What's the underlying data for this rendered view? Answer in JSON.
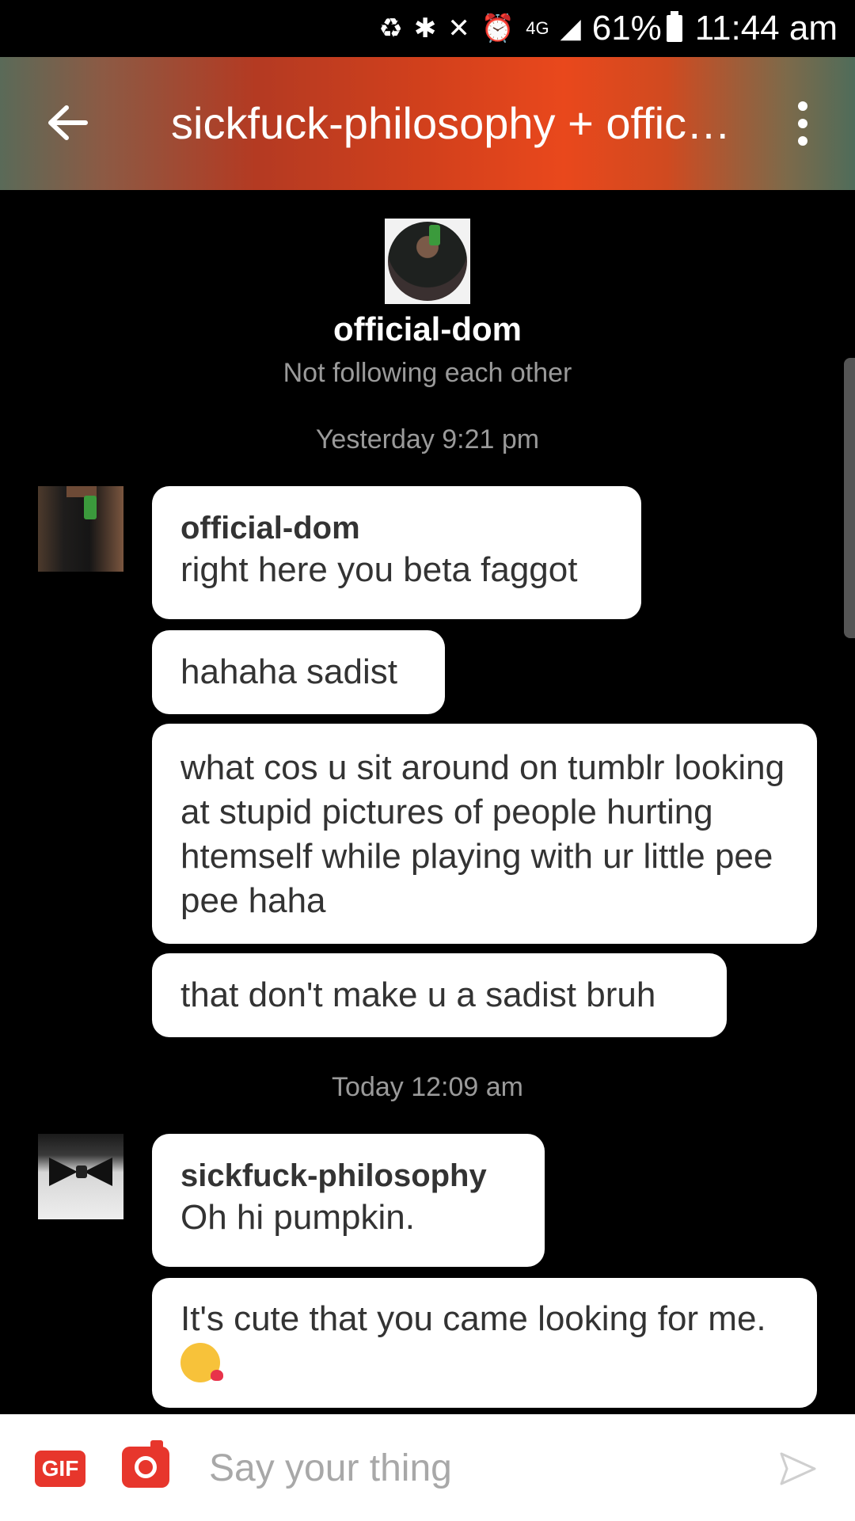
{
  "status_bar": {
    "battery_percent": "61%",
    "time": "11:44 am",
    "network": "4G",
    "icons": [
      "recycle-icon",
      "bluetooth-icon",
      "mute-icon",
      "alarm-icon",
      "network-4g-icon",
      "signal-icon",
      "battery-icon"
    ]
  },
  "header": {
    "title": "sickfuck-philosophy + offic…",
    "back_icon": "back-arrow-icon",
    "menu_icon": "more-vertical-icon"
  },
  "profile": {
    "name": "official-dom",
    "relationship": "Not following each other"
  },
  "timestamps": {
    "first": "Yesterday 9:21 pm",
    "second": "Today 12:09 am"
  },
  "messages": [
    {
      "author": "official-dom",
      "text": "right here you beta faggot"
    },
    {
      "text": "hahaha sadist"
    },
    {
      "text": "what cos u sit around on tumblr looking at stupid pictures of people hurting htemself while playing with ur little pee pee haha"
    },
    {
      "text": "that don't make u a sadist bruh"
    },
    {
      "author": "sickfuck-philosophy",
      "text": "Oh hi pumpkin."
    },
    {
      "text": "It's cute that you came looking for me.",
      "emoji": "kissing-face-icon"
    }
  ],
  "composer": {
    "gif_label": "GIF",
    "placeholder": "Say your thing"
  }
}
